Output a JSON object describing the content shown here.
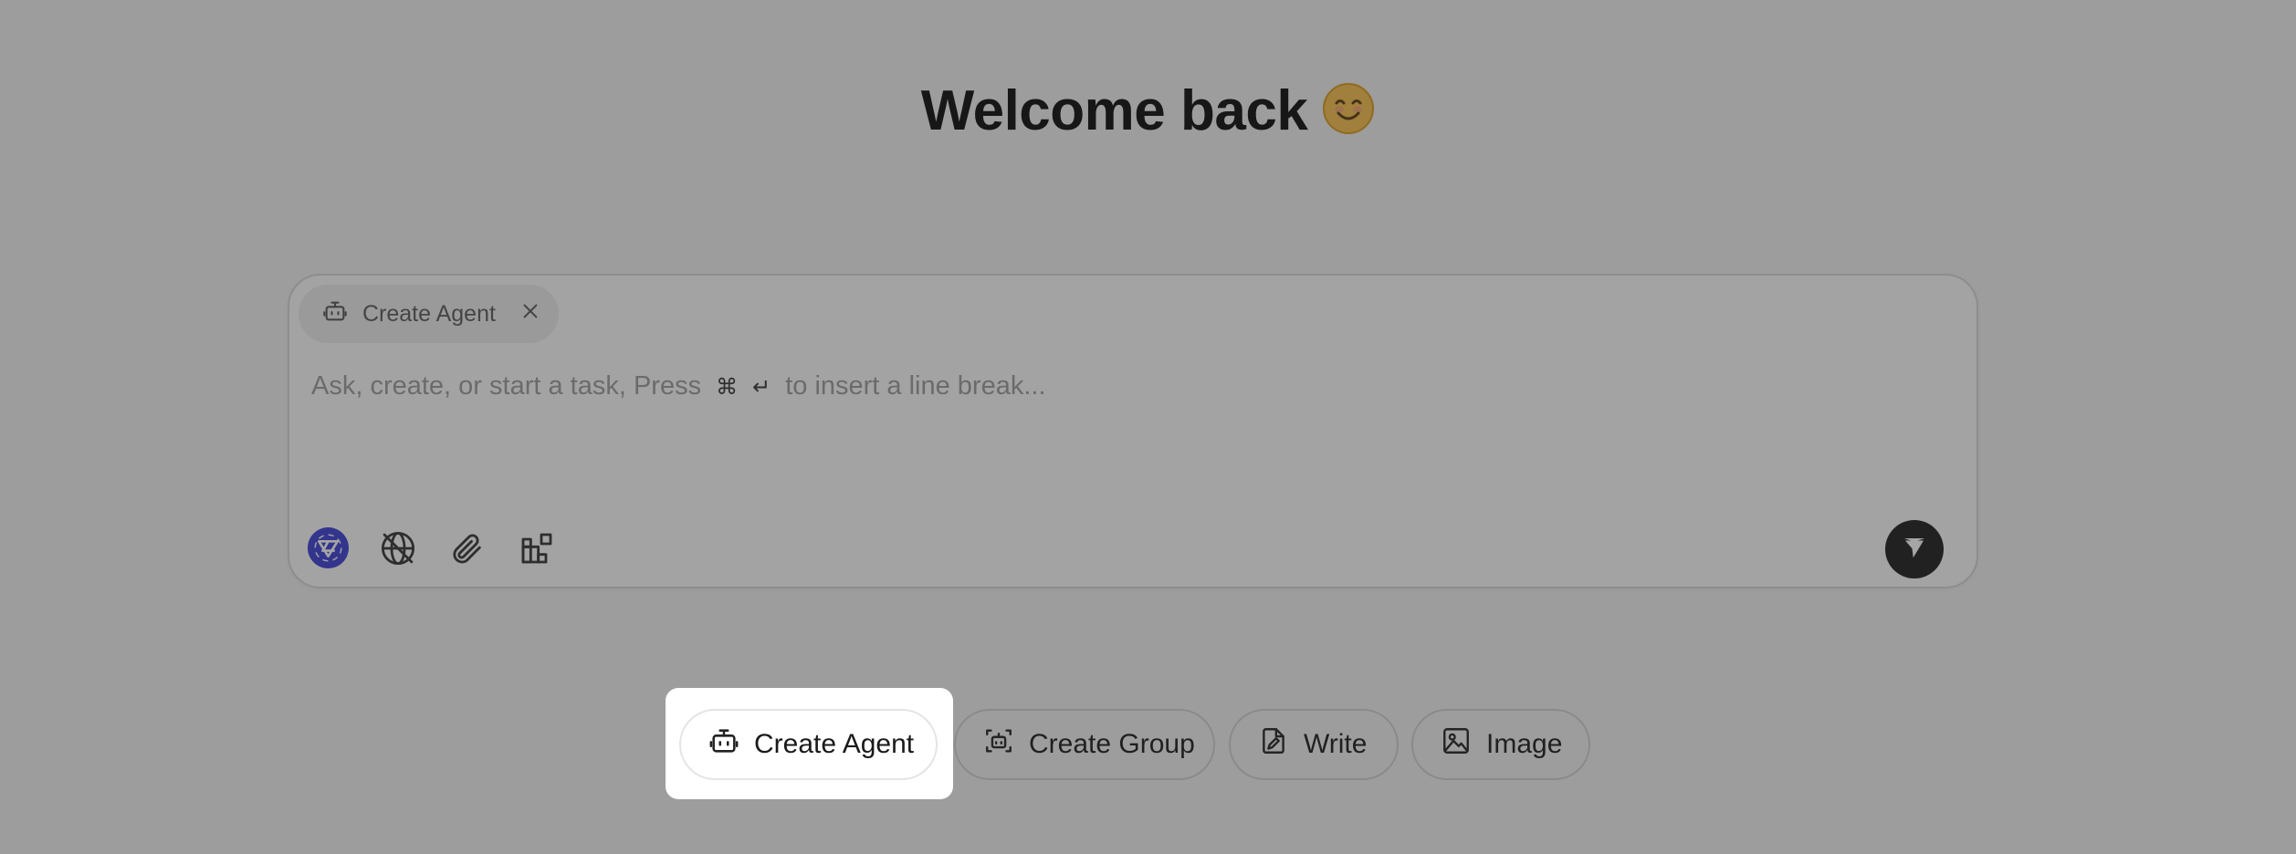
{
  "header": {
    "title": "Welcome back",
    "emoji": "😊"
  },
  "composer": {
    "chip": {
      "label": "Create Agent",
      "icon": "robot-icon",
      "close_icon": "close-icon"
    },
    "placeholder_start": "Ask, create, or start a task, Press",
    "shortcut_cmd": "⌘",
    "shortcut_enter": "↵",
    "placeholder_end": "to insert a line break...",
    "tools": [
      "model-logo-icon",
      "globe-off-icon",
      "paperclip-icon",
      "apps-icon"
    ],
    "send_icon": "send-icon",
    "accent": "#3b3fd6"
  },
  "actions": [
    {
      "label": "Create Agent",
      "icon": "robot-icon",
      "highlighted": true
    },
    {
      "label": "Create Group",
      "icon": "group-scan-icon"
    },
    {
      "label": "Write",
      "icon": "document-pen-icon"
    },
    {
      "label": "Image",
      "icon": "image-icon"
    }
  ]
}
